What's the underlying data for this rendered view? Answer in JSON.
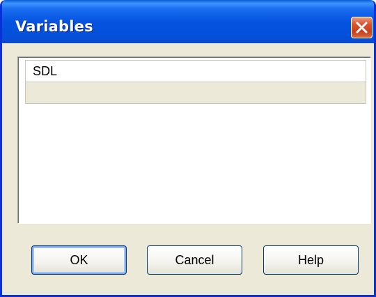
{
  "window": {
    "title": "Variables"
  },
  "list": {
    "rows": [
      {
        "text": "SDL",
        "selected": false
      },
      {
        "text": "",
        "selected": false
      }
    ]
  },
  "buttons": {
    "ok_label": "OK",
    "cancel_label": "Cancel",
    "help_label": "Help"
  },
  "icons": {
    "close": "close-icon"
  },
  "colors": {
    "titlebar": "#0553e0",
    "window_bg": "#ece9d8",
    "close_button": "#d8522e",
    "button_border": "#003c74"
  }
}
